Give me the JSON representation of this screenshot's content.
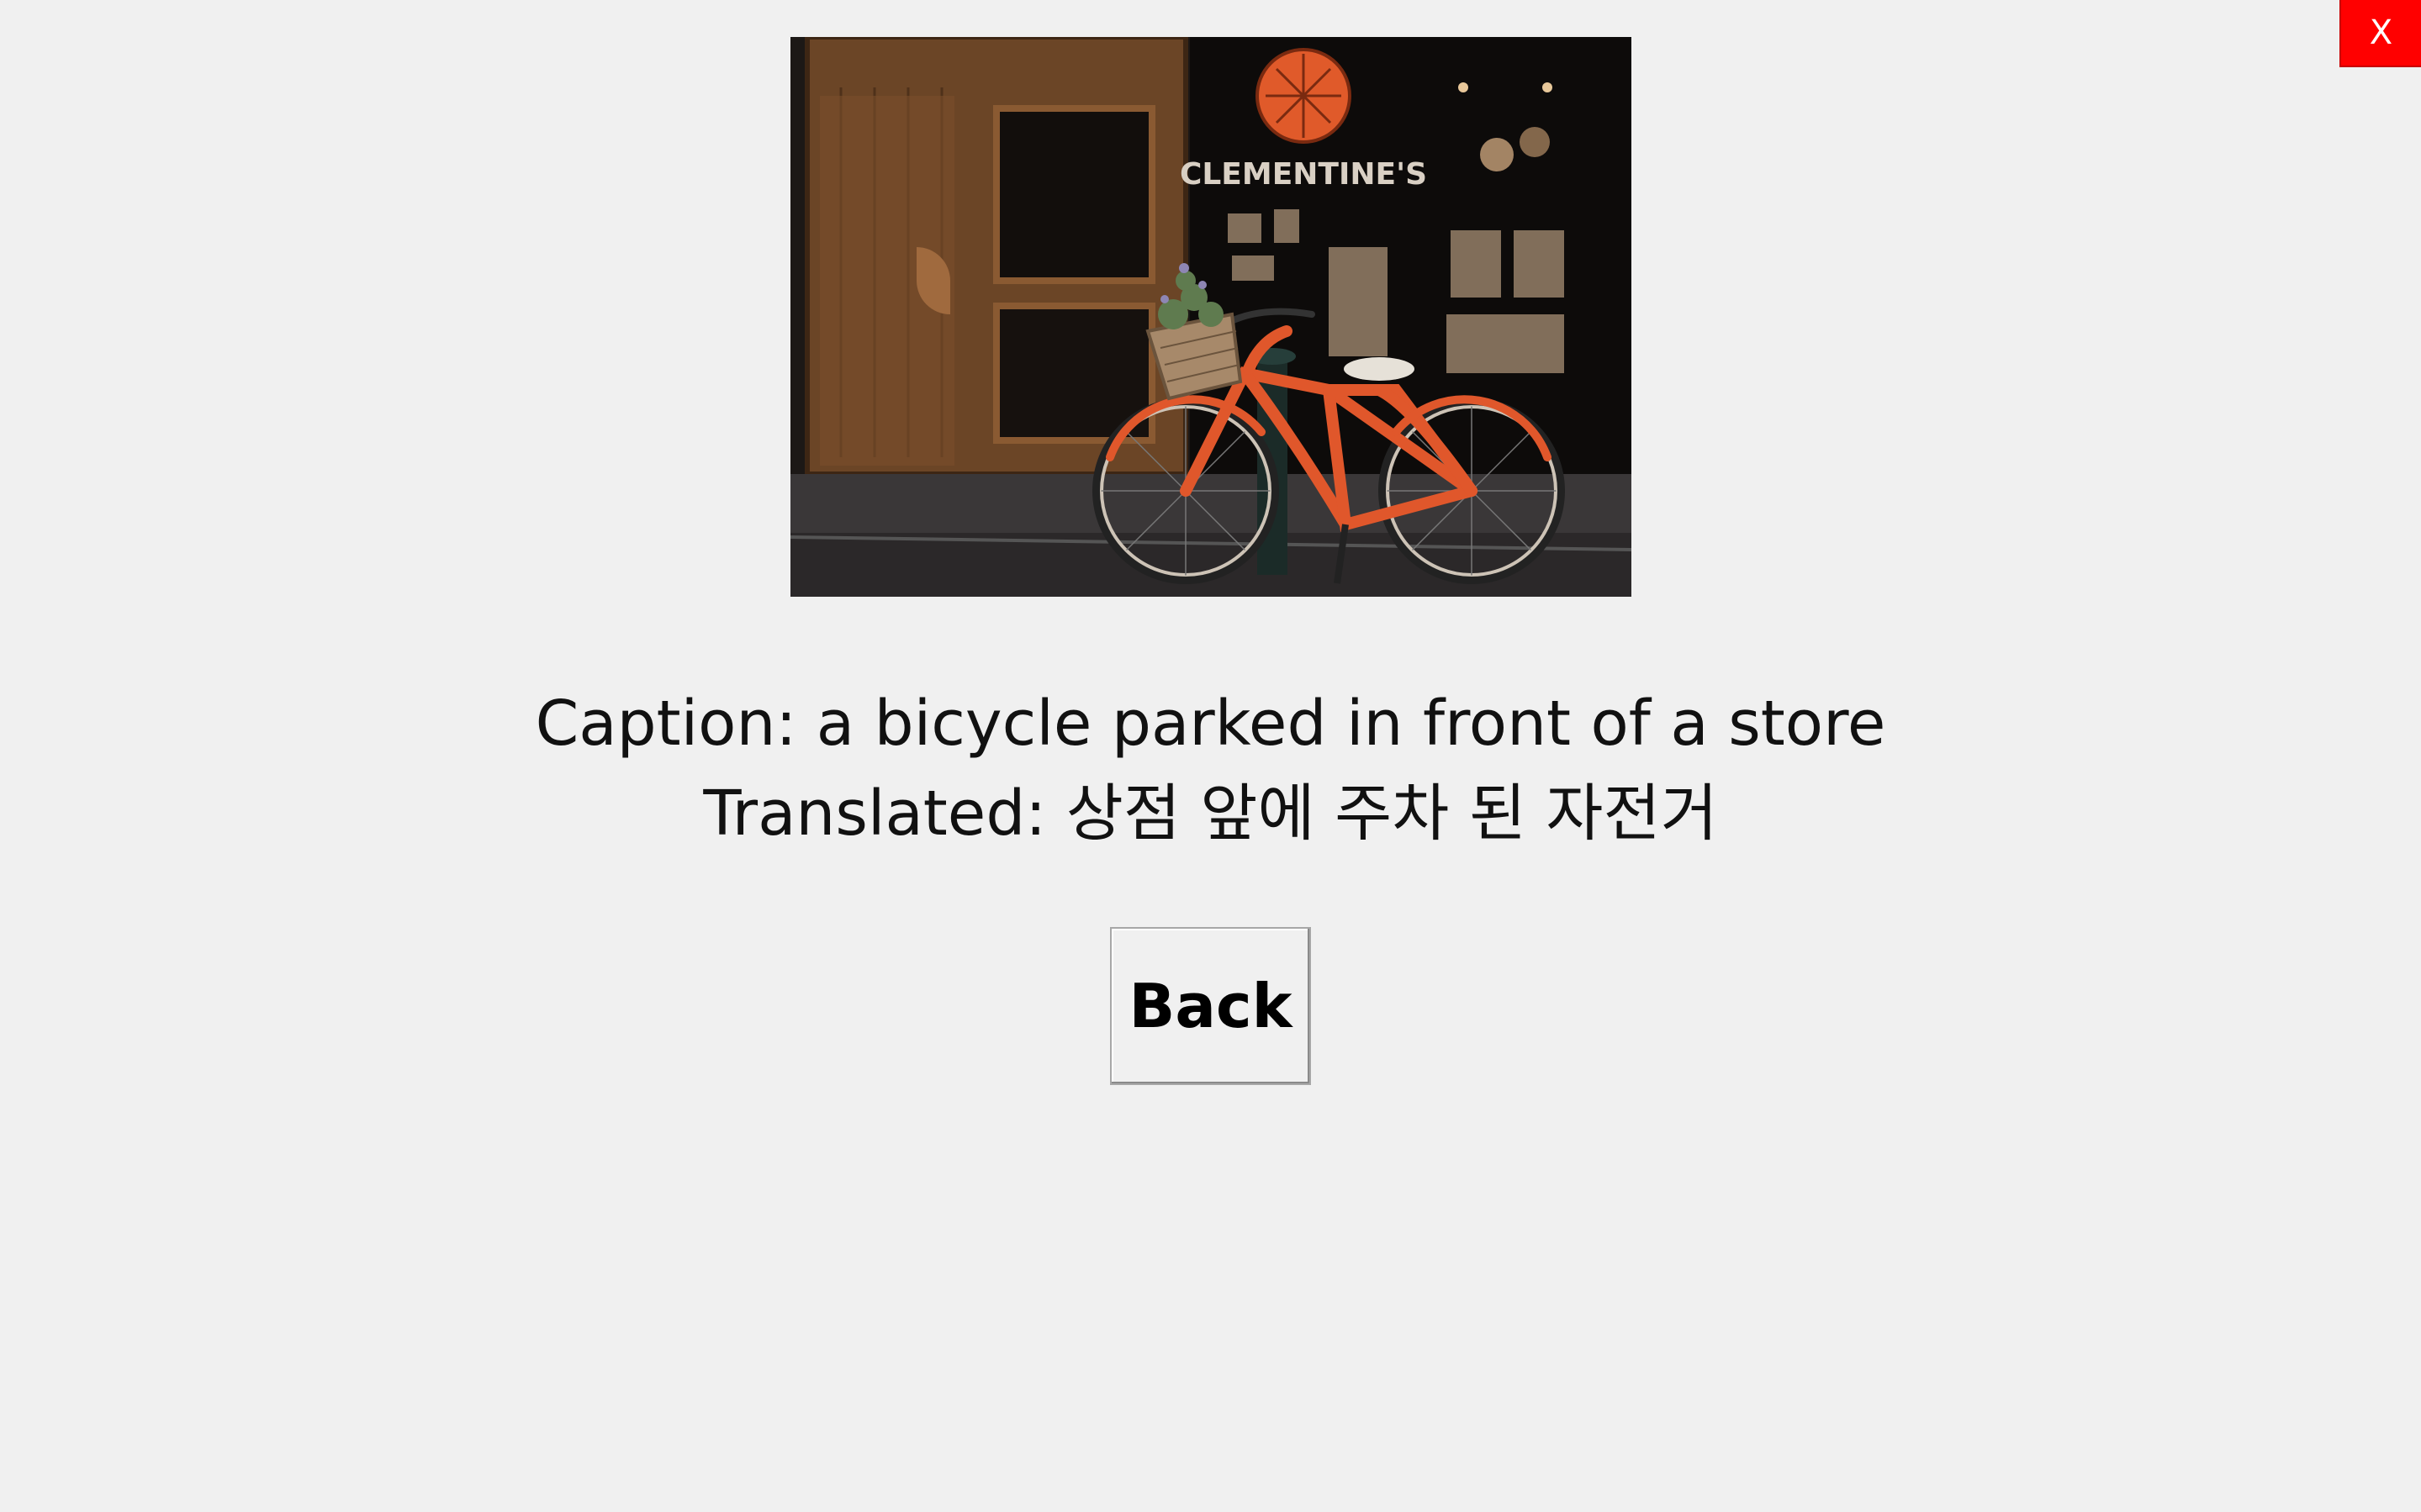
{
  "window": {
    "close_label": "X",
    "close_color": "#ff0000"
  },
  "image": {
    "description_icon": "bicycle-photo",
    "sign_text": "CLEMENTINE'S"
  },
  "caption": {
    "english": "Caption: a bicycle parked in front of a store",
    "translated": "Translated: 상점 앞에 주차 된 자전거"
  },
  "actions": {
    "back_label": "Back"
  }
}
